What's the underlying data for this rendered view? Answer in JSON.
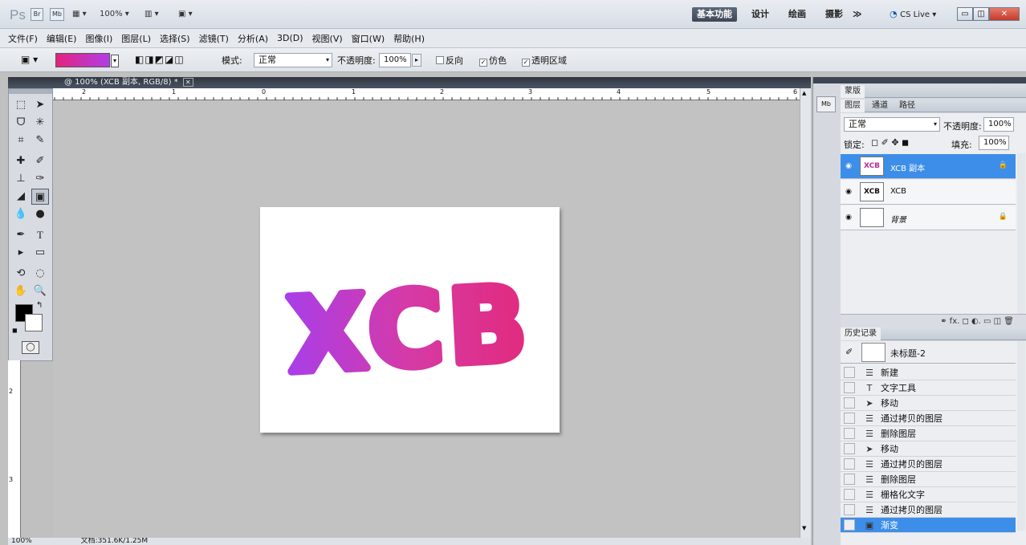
{
  "app": {
    "logo": "Ps",
    "zoom": "100%"
  },
  "title_bar": {
    "icons": [
      "Br",
      "Mb"
    ],
    "workspaces": [
      {
        "label": "基本功能",
        "active": true
      },
      {
        "label": "设计",
        "active": false
      },
      {
        "label": "绘画",
        "active": false
      },
      {
        "label": "摄影",
        "active": false
      }
    ],
    "more": "≫",
    "cs_live": "CS Live ▾"
  },
  "menu": [
    "文件(F)",
    "编辑(E)",
    "图像(I)",
    "图层(L)",
    "选择(S)",
    "滤镜(T)",
    "分析(A)",
    "3D(D)",
    "视图(V)",
    "窗口(W)",
    "帮助(H)"
  ],
  "options": {
    "mode_label": "模式:",
    "mode_value": "正常",
    "opacity_label": "不透明度:",
    "opacity_value": "100%",
    "reverse_label": "反向",
    "dither_label": "仿色",
    "transparency_label": "透明区域",
    "gradient_colors": [
      "#e2247e",
      "#b13ee6"
    ]
  },
  "document": {
    "tab_title": "@ 100% (XCB 副本, RGB/8) *",
    "canvas_text": "XCB",
    "text_gradient": [
      "#a93ee8",
      "#d63aa6",
      "#e22a7c"
    ]
  },
  "ruler": {
    "top": [
      "2",
      "1",
      "0",
      "1",
      "2",
      "3",
      "4",
      "5",
      "6"
    ],
    "left": [
      "2",
      "3"
    ]
  },
  "status": {
    "zoom": "100%",
    "doc_info": "文档:351.6K/1.25M"
  },
  "panels": {
    "mask_tab": "蒙版",
    "layers_tabs": [
      "图层",
      "通道",
      "路径"
    ],
    "blend_mode": "正常",
    "opacity_label": "不透明度:",
    "opacity_value": "100%",
    "lock_label": "锁定:",
    "fill_label": "填充:",
    "fill_value": "100%",
    "layers": [
      {
        "name": "XCB 副本",
        "thumb": "XCB",
        "active": true
      },
      {
        "name": "XCB",
        "thumb": "XCB",
        "active": false
      },
      {
        "name": "背景",
        "thumb": "",
        "active": false
      }
    ],
    "footer_icons": "⚭ fx. ◻ ◐. ▭ ◫ 🗑",
    "history_tab": "历史记录",
    "history_snapshot": "未标题-2",
    "history": [
      {
        "label": "新建",
        "icon": "doc-icon"
      },
      {
        "label": "文字工具",
        "icon": "type-icon"
      },
      {
        "label": "移动",
        "icon": "move-icon"
      },
      {
        "label": "通过拷贝的图层",
        "icon": "doc-icon"
      },
      {
        "label": "删除图层",
        "icon": "doc-icon"
      },
      {
        "label": "移动",
        "icon": "move-icon"
      },
      {
        "label": "通过拷贝的图层",
        "icon": "doc-icon"
      },
      {
        "label": "删除图层",
        "icon": "doc-icon"
      },
      {
        "label": "栅格化文字",
        "icon": "doc-icon"
      },
      {
        "label": "通过拷贝的图层",
        "icon": "doc-icon"
      },
      {
        "label": "渐变",
        "icon": "gradient-icon",
        "active": true
      }
    ]
  }
}
